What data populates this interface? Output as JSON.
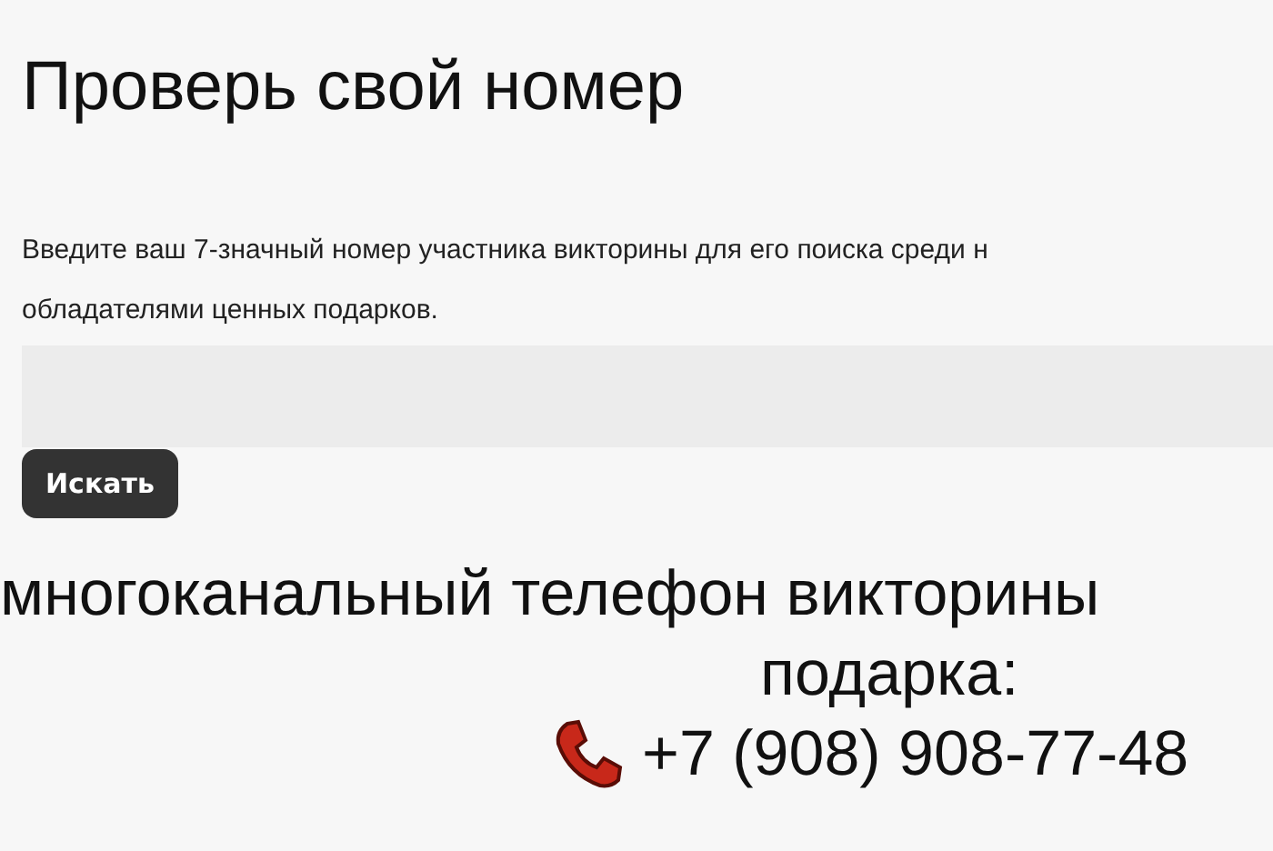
{
  "heading": "Проверь свой номер",
  "description_lines": [
    "Введите ваш 7-значный номер участника викторины для его поиска среди н",
    "обладателями ценных подарков."
  ],
  "search": {
    "button": "Искать"
  },
  "hotline": {
    "lines": [
      "многоканальный телефон викторины",
      "подарка:"
    ],
    "phone": "+7 (908) 908-77-48"
  }
}
